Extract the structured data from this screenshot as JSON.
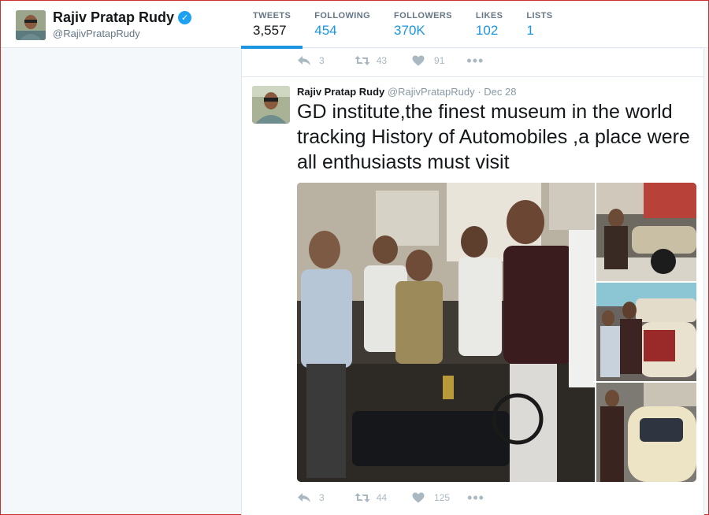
{
  "profile": {
    "name": "Rajiv Pratap Rudy",
    "handle": "@RajivPratapRudy",
    "verified_glyph": "✓"
  },
  "nav": {
    "stats": [
      {
        "label": "TWEETS",
        "value": "3,557",
        "active": true
      },
      {
        "label": "FOLLOWING",
        "value": "454"
      },
      {
        "label": "FOLLOWERS",
        "value": "370K"
      },
      {
        "label": "LIKES",
        "value": "102"
      },
      {
        "label": "LISTS",
        "value": "1"
      }
    ]
  },
  "previous_tweet": {
    "actions": {
      "reply": "3",
      "retweet": "43",
      "like": "91"
    }
  },
  "tweet": {
    "fullname": "Rajiv Pratap Rudy",
    "handle": "@RajivPratapRudy",
    "dot": "·",
    "date": "Dec 28",
    "text": "GD institute,the finest museum in the world tracking History of Automobiles ,a place were all enthusiasts must visit",
    "actions": {
      "reply": "3",
      "retweet": "44",
      "like": "125"
    }
  },
  "icons": {
    "reply": "reply-icon",
    "retweet": "retweet-icon",
    "like": "heart-icon",
    "more": "more-icon",
    "verified": "verified-icon"
  },
  "colors": {
    "accent": "#1b95e0",
    "muted": "#aab8c2",
    "verified": "#1da1f2"
  }
}
